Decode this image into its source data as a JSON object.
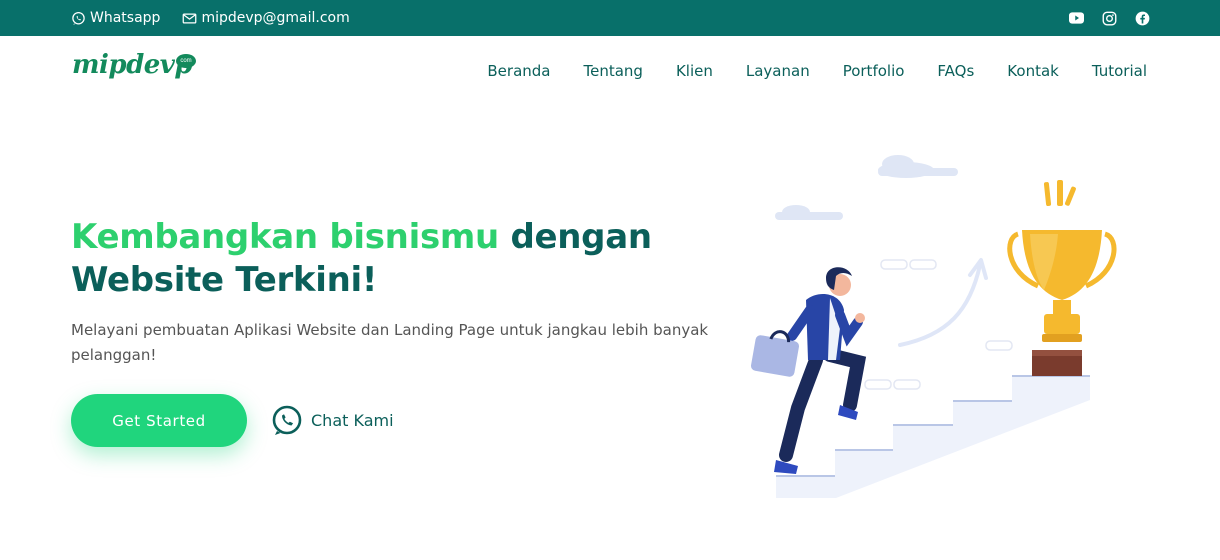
{
  "topbar": {
    "whatsapp_label": "Whatsapp",
    "email_label": "mipdevp@gmail.com",
    "social_icons": [
      "youtube-icon",
      "instagram-icon",
      "facebook-icon"
    ]
  },
  "header": {
    "logo_text": "mipdevp",
    "logo_badge": "com",
    "nav": [
      {
        "label": "Beranda"
      },
      {
        "label": "Tentang"
      },
      {
        "label": "Klien"
      },
      {
        "label": "Layanan"
      },
      {
        "label": "Portfolio"
      },
      {
        "label": "FAQs"
      },
      {
        "label": "Kontak"
      },
      {
        "label": "Tutorial"
      }
    ]
  },
  "hero": {
    "title_highlight": "Kembangkan bisnismu",
    "title_rest_1": " dengan",
    "title_rest_2": "Website Terkini!",
    "subtitle": "Melayani pembuatan Aplikasi Website dan Landing Page untuk jangkau lebih banyak pelanggan!",
    "cta_primary": "Get Started",
    "cta_secondary": "Chat Kami"
  },
  "colors": {
    "topbar": "#08706a",
    "primary_dark": "#0b5f5a",
    "accent_green": "#2dd06e",
    "button_green": "#20d57d",
    "trophy": "#f5b92e"
  }
}
